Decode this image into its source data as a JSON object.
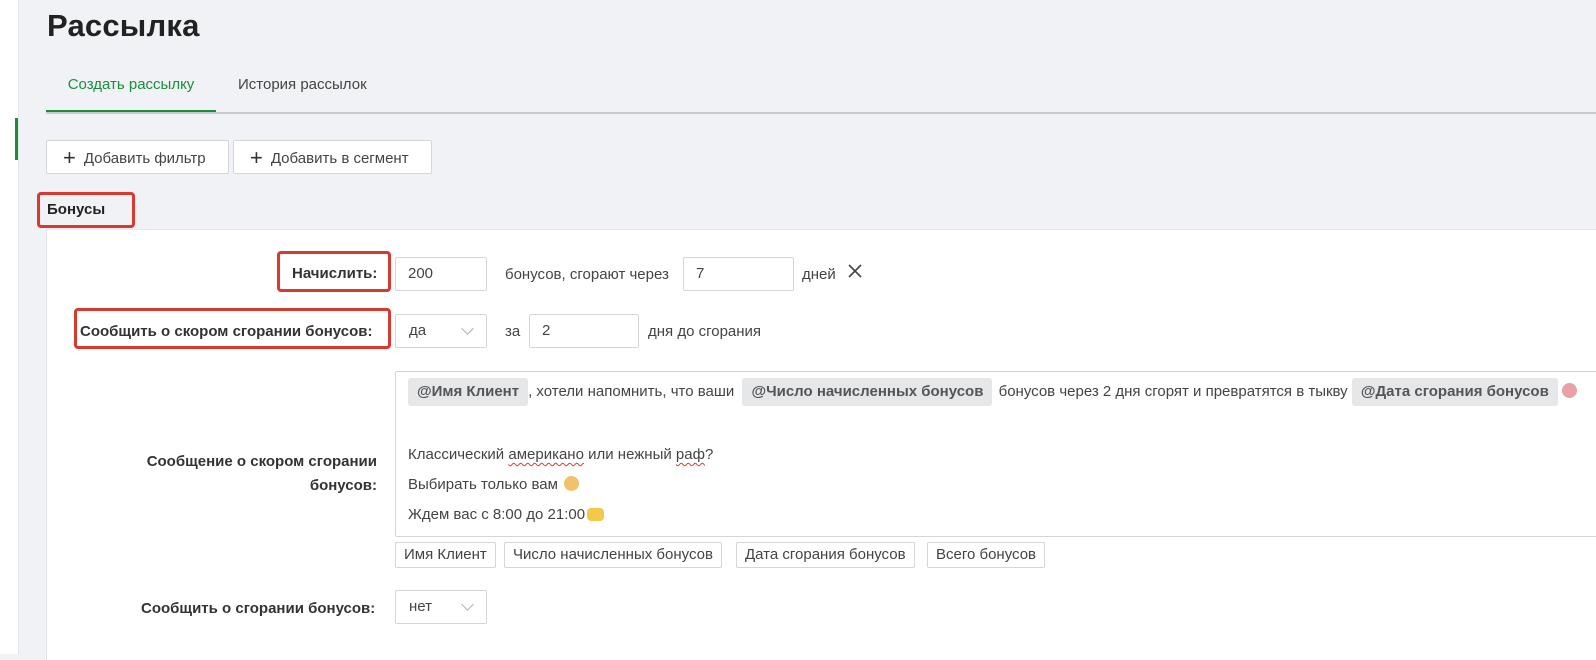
{
  "page": {
    "title": "Рассылка"
  },
  "tabs": [
    {
      "label": "Создать рассылку",
      "active": true
    },
    {
      "label": "История рассылок",
      "active": false
    }
  ],
  "actions": {
    "add_filter": "Добавить фильтр",
    "add_segment": "Добавить в сегмент"
  },
  "section": {
    "title": "Бонусы"
  },
  "accrue": {
    "label": "Начислить:",
    "amount": "200",
    "middle_text": "бонусов, сгорают через",
    "days": "7",
    "days_unit": "дней"
  },
  "notify_expiring": {
    "label": "Сообщить о скором сгорании бонусов:",
    "value": "да",
    "prefix": "за",
    "days": "2",
    "suffix": "дня до сгорания"
  },
  "expiring_message": {
    "label_line1": "Сообщение о скором сгорании",
    "label_line2": "бонусов:",
    "line1": {
      "mention_name": "@Имя Клиент",
      "text1": ", хотели напомнить, что ваши",
      "mention_bonuses": "@Число начисленных бонусов",
      "text2": "бонусов через 2 дня сгорят и превратятся в тыкву",
      "mention_date": "@Дата сгорания бонусов"
    },
    "line2": {
      "pre": "Классический ",
      "word_americano": "американо",
      "mid": " или нежный ",
      "word_raf": "раф",
      "post": "?"
    },
    "line3": "Выбирать только вам",
    "line4": "Ждем вас с 8:00 до 21:00",
    "variables": [
      "Имя Клиент",
      "Число начисленных бонусов",
      "Дата сгорания бонусов",
      "Всего бонусов"
    ]
  },
  "notify_expired": {
    "label": "Сообщить о сгорании бонусов:",
    "value": "нет"
  },
  "icons": {
    "plus": "plus-icon",
    "close": "close-icon",
    "chevron": "chevron-down-icon",
    "emoji_pumpkin": "pumpkin-emoji-icon",
    "emoji_smile": "smile-emoji-icon",
    "emoji_hands": "heart-hands-emoji-icon"
  },
  "colors": {
    "accent": "#1a8d3d",
    "highlight_box": "#d83a2f",
    "background": "#f0f2f5"
  }
}
